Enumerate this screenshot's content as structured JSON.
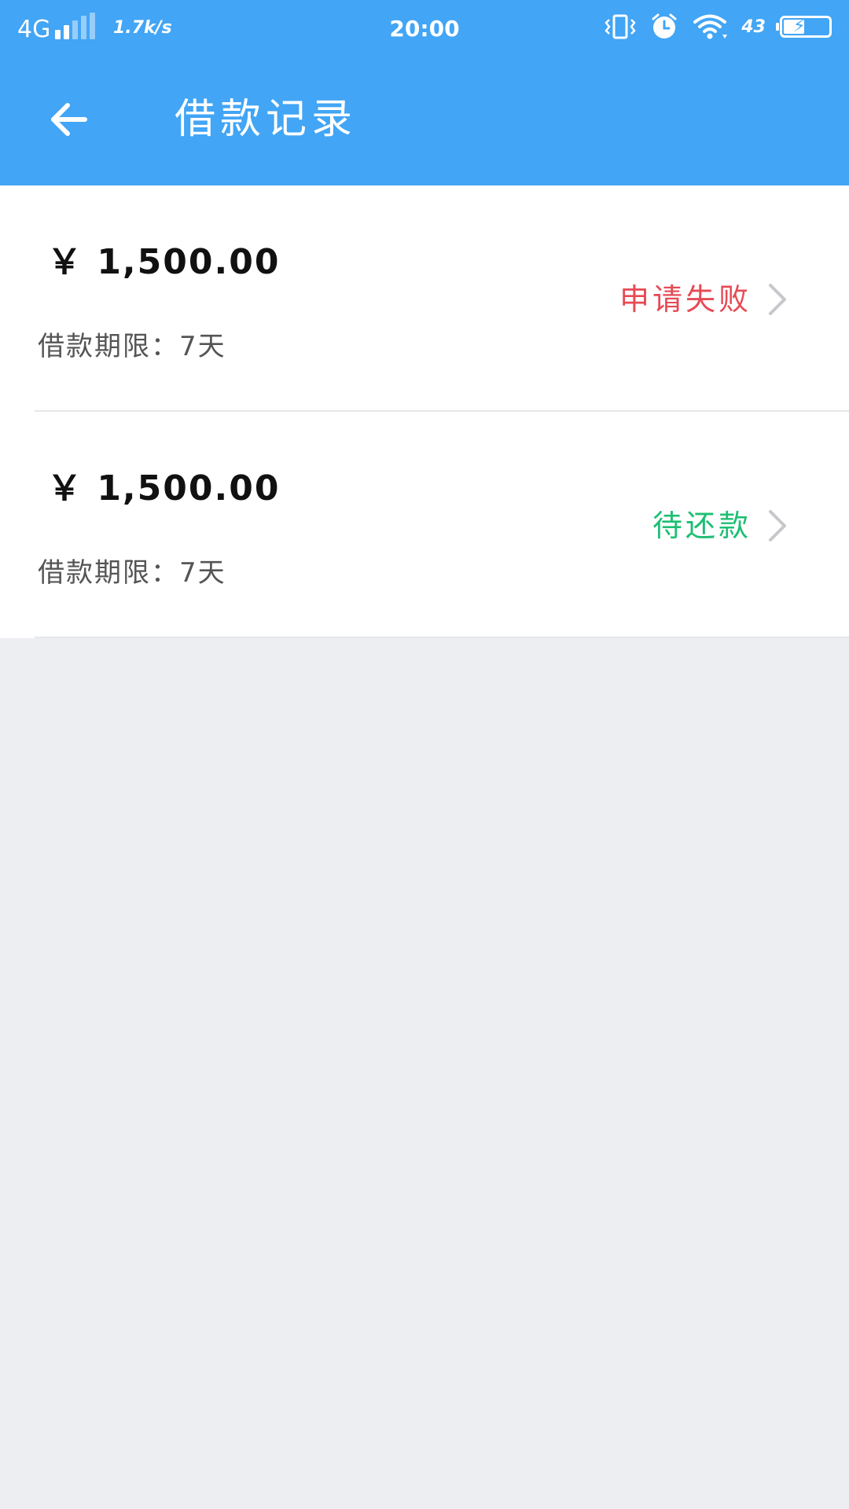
{
  "status_bar": {
    "network": "4G",
    "speed": "1.7k/s",
    "time": "20:00",
    "battery_pct": "43",
    "icons": [
      "vibrate-icon",
      "alarm-icon",
      "wifi-icon",
      "battery-icon"
    ]
  },
  "header": {
    "title": "借款记录",
    "back_icon": "arrow-left-icon"
  },
  "records": [
    {
      "amount": "￥ 1,500.00",
      "term": "借款期限：7天",
      "status": "申请失败",
      "status_color": "#e64b55"
    },
    {
      "amount": "￥ 1,500.00",
      "term": "借款期限：7天",
      "status": "待还款",
      "status_color": "#1dbf73"
    }
  ],
  "colors": {
    "primary": "#42a5f5",
    "background": "#eceef2",
    "failed": "#e64b55",
    "pending": "#1dbf73",
    "chevron": "#c7c7cc"
  }
}
